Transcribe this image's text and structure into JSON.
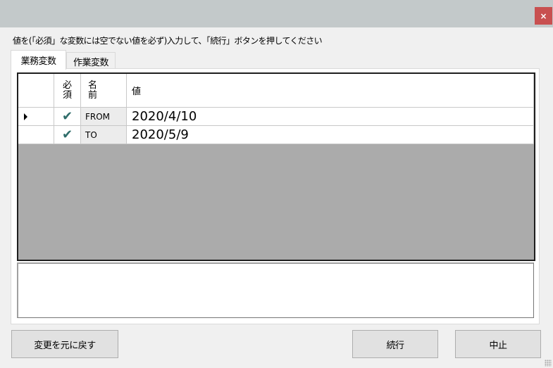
{
  "window": {
    "title": "",
    "close_label": "×"
  },
  "instruction": "値を(「必須」な変数には空でない値を必ず)入力して、「続行」ボタンを押してください",
  "tabs": [
    {
      "label": "業務変数",
      "active": true
    },
    {
      "label": "作業変数",
      "active": false
    }
  ],
  "grid": {
    "columns": [
      {
        "key": "row_header",
        "label": ""
      },
      {
        "key": "required",
        "label_line1": "必",
        "label_line2": "須"
      },
      {
        "key": "name",
        "label_line1": "名",
        "label_line2": "前"
      },
      {
        "key": "value",
        "label": "値"
      }
    ],
    "rows": [
      {
        "current": true,
        "required": true,
        "required_icon": "check-icon",
        "name": "FROM",
        "value": "2020/4/10"
      },
      {
        "current": false,
        "required": true,
        "required_icon": "check-icon",
        "name": "TO",
        "value": "2020/5/9"
      }
    ]
  },
  "description_text": "",
  "buttons": {
    "revert": "変更を元に戻す",
    "continue": "続行",
    "abort": "中止"
  },
  "colors": {
    "titlebar": "#c3c9ca",
    "close_button": "#c85050",
    "check": "#2f6d6a",
    "grid_empty_area": "#ababab"
  }
}
